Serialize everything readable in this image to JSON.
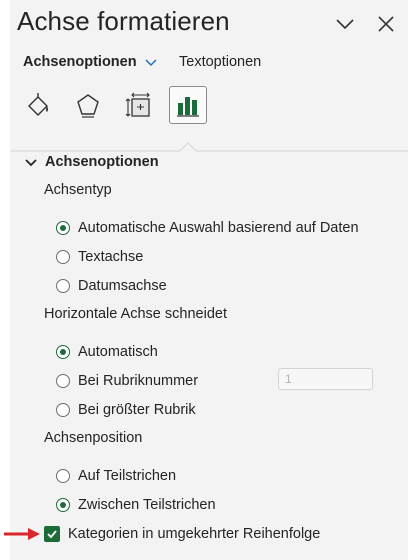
{
  "pane": {
    "title": "Achse formatieren",
    "collapse_icon": "chevron-down-icon",
    "close_icon": "close-icon"
  },
  "tabs": [
    {
      "label": "Achsenoptionen",
      "active": true
    },
    {
      "label": "Textoptionen",
      "active": false
    }
  ],
  "icon_tabs": [
    {
      "icon": "fill-line-icon",
      "selected": false
    },
    {
      "icon": "effects-pentagon-icon",
      "selected": false
    },
    {
      "icon": "size-properties-icon",
      "selected": false
    },
    {
      "icon": "axis-options-bar-chart-icon",
      "selected": true
    }
  ],
  "section": {
    "title": "Achsenoptionen",
    "expanded": true
  },
  "axis_type": {
    "label": "Achsentyp",
    "options": [
      {
        "label": "Automatische Auswahl basierend auf Daten",
        "checked": true
      },
      {
        "label": "Textachse",
        "checked": false
      },
      {
        "label": "Datumsachse",
        "checked": false
      }
    ]
  },
  "crosses": {
    "label": "Horizontale Achse schneidet",
    "options": [
      {
        "label": "Automatisch",
        "checked": true
      },
      {
        "label": "Bei Rubriknummer",
        "checked": false
      },
      {
        "label": "Bei größter Rubrik",
        "checked": false
      }
    ],
    "category_number_value": "1"
  },
  "position": {
    "label": "Achsenposition",
    "options": [
      {
        "label": "Auf Teilstrichen",
        "checked": false
      },
      {
        "label": "Zwischen Teilstrichen",
        "checked": true
      }
    ]
  },
  "reverse_order": {
    "label": "Kategorien in umgekehrter Reihenfolge",
    "checked": true
  },
  "colors": {
    "accent": "#1e6b3a",
    "annotation_arrow": "#d9262b",
    "pane_bg": "#f3f3f3"
  }
}
